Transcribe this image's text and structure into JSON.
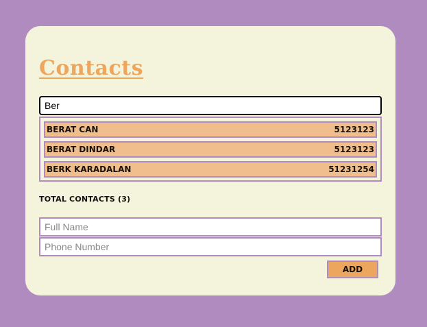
{
  "app": {
    "title": "Contacts"
  },
  "search": {
    "value": "Ber"
  },
  "results": [
    {
      "name": "BERAT CAN",
      "phone": "5123123"
    },
    {
      "name": "BERAT DINDAR",
      "phone": "5123123"
    },
    {
      "name": "BERK KARADALAN",
      "phone": "51231254"
    }
  ],
  "total": {
    "label": "TOTAL CONTACTS (3)"
  },
  "form": {
    "name_placeholder": "Full Name",
    "phone_placeholder": "Phone Number",
    "add_label": "ADD"
  },
  "colors": {
    "background": "#b08bbf",
    "card": "#f4f4dc",
    "accent": "#eda65e",
    "row": "#efbe8c",
    "border": "#b08bbf"
  }
}
